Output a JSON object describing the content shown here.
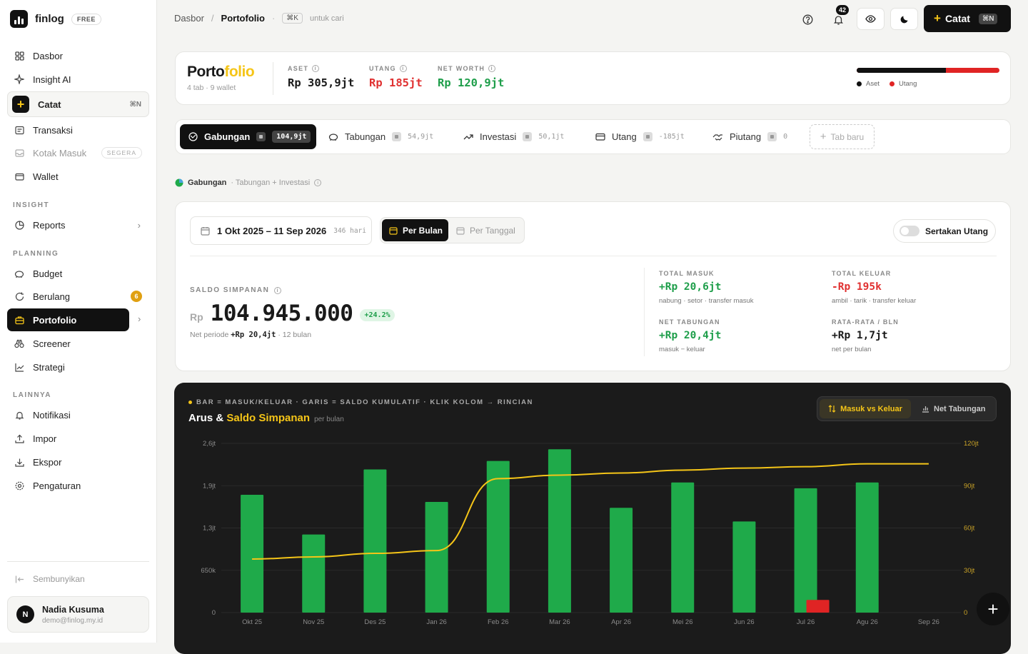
{
  "brand": {
    "name": "finlog",
    "plan": "FREE"
  },
  "nav": {
    "dasbor": "Dasbor",
    "insight_ai": "Insight AI",
    "catat": {
      "label": "Catat",
      "shortcut": "⌘N"
    },
    "transaksi": "Transaksi",
    "kotak_masuk": {
      "label": "Kotak Masuk",
      "badge": "SEGERA"
    },
    "wallet": "Wallet",
    "sec_insight": "INSIGHT",
    "reports": "Reports",
    "sec_planning": "PLANNING",
    "budget": "Budget",
    "berulang": {
      "label": "Berulang",
      "count": "6"
    },
    "portofolio": "Portofolio",
    "screener": "Screener",
    "strategi": "Strategi",
    "sec_lainnya": "LAINNYA",
    "notifikasi": "Notifikasi",
    "impor": "Impor",
    "ekspor": "Ekspor",
    "pengaturan": "Pengaturan",
    "hide": "Sembunyikan"
  },
  "user": {
    "initial": "N",
    "name": "Nadia Kusuma",
    "email": "demo@finlog.my.id"
  },
  "topbar": {
    "crumb_root": "Dasbor",
    "crumb_sep": "/",
    "crumb_current": "Portofolio",
    "dot": "·",
    "search_kbd": "⌘K",
    "search_hint": "untuk cari",
    "notif_count": "42",
    "catat_label": "Catat",
    "catat_kbd": "⌘N"
  },
  "portfolio": {
    "title_a": "Porto",
    "title_b": "folio",
    "subtitle": "4 tab · 9 wallet",
    "aset_label": "ASET",
    "aset_value": "Rp 305,9jt",
    "utang_label": "UTANG",
    "utang_value": "Rp 185jt",
    "net_label": "NET WORTH",
    "net_value": "Rp 120,9jt",
    "legend_aset": "Aset",
    "legend_utang": "Utang",
    "aset_share": 0.623
  },
  "tabs": [
    {
      "label": "Gabungan",
      "amount": "104,9jt"
    },
    {
      "label": "Tabungan",
      "amount": "54,9jt"
    },
    {
      "label": "Investasi",
      "amount": "50,1jt"
    },
    {
      "label": "Utang",
      "amount": "-185jt"
    },
    {
      "label": "Piutang",
      "amount": "0"
    }
  ],
  "new_tab": "Tab baru",
  "gabungan": {
    "label": "Gabungan",
    "desc": "· Tabungan + Investasi"
  },
  "period": {
    "range": "1 Okt 2025 – 11 Sep 2026",
    "days": "346 hari",
    "per_bulan": "Per Bulan",
    "per_tanggal": "Per Tanggal",
    "toggle": "Sertakan Utang"
  },
  "saldo": {
    "label": "SALDO SIMPANAN",
    "currency": "Rp",
    "value": "104.945.000",
    "change": "+24.2%",
    "net_prefix": "Net periode",
    "net_value": "+Rp 20,4jt",
    "net_suffix": "· 12 bulan"
  },
  "metrics": {
    "masuk": {
      "label": "TOTAL MASUK",
      "value": "+Rp 20,6jt",
      "sub": "nabung · setor · transfer masuk"
    },
    "keluar": {
      "label": "TOTAL KELUAR",
      "value": "-Rp 195k",
      "sub": "ambil · tarik · transfer keluar"
    },
    "net": {
      "label": "NET TABUNGAN",
      "value": "+Rp 20,4jt",
      "sub": "masuk − keluar"
    },
    "rata": {
      "label": "RATA-RATA / BLN",
      "value": "+Rp 1,7jt",
      "sub": "net per bulan"
    }
  },
  "chart_panel": {
    "caption": "BAR = MASUK/KELUAR · GARIS = SALDO KUMULATIF · KLIK KOLOM → RINCIAN",
    "title_a": "Arus &",
    "title_b": "Saldo Simpanan",
    "title_c": "per bulan",
    "seg_a": "Masuk vs Keluar",
    "seg_b": "Net Tabungan"
  },
  "colors": {
    "masuk": "#1faa4a",
    "keluar": "#e02424",
    "saldo": "#f5c518"
  },
  "chart_data": {
    "type": "bar",
    "categories": [
      "Okt 25",
      "Nov 25",
      "Des 25",
      "Jan 26",
      "Feb 26",
      "Mar 26",
      "Apr 26",
      "Mei 26",
      "Jun 26",
      "Jul 26",
      "Agu 26",
      "Sep 26"
    ],
    "y_left_ticks": [
      "0",
      "650k",
      "1,3jt",
      "1,9jt",
      "2,6jt"
    ],
    "y_left_max": 2600000,
    "y_right_ticks": [
      "0",
      "30jt",
      "60jt",
      "90jt",
      "120jt"
    ],
    "y_right_max": 120000000,
    "series": [
      {
        "values": [
          1810000,
          1200000,
          2200000,
          1700000,
          2330000,
          2510000,
          1610000,
          2000000,
          1400000,
          1910000,
          2000000,
          0
        ]
      },
      {
        "values": [
          0,
          0,
          0,
          0,
          0,
          0,
          0,
          0,
          0,
          195000,
          0,
          0
        ]
      },
      {
        "values": [
          38000000,
          39500000,
          42000000,
          44000000,
          95000000,
          97500000,
          99000000,
          101000000,
          102500000,
          103500000,
          105500000,
          105500000
        ]
      }
    ]
  }
}
